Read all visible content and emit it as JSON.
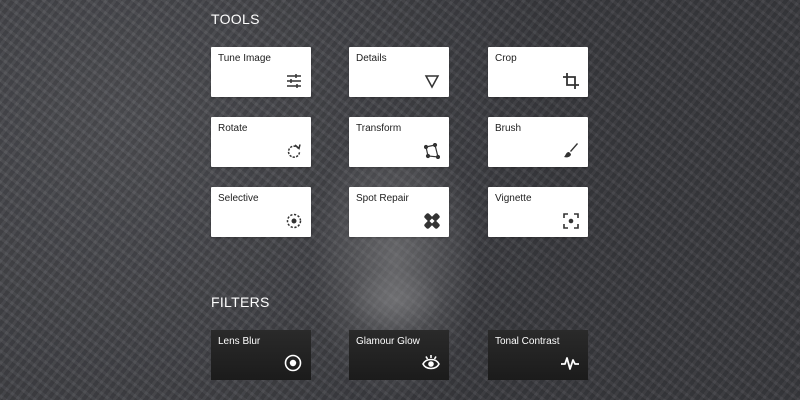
{
  "sections": {
    "tools_title": "TOOLS",
    "filters_title": "FILTERS"
  },
  "tools": [
    {
      "label": "Tune Image",
      "icon": "sliders-icon"
    },
    {
      "label": "Details",
      "icon": "triangle-down-icon"
    },
    {
      "label": "Crop",
      "icon": "crop-icon"
    },
    {
      "label": "Rotate",
      "icon": "rotate-icon"
    },
    {
      "label": "Transform",
      "icon": "perspective-icon"
    },
    {
      "label": "Brush",
      "icon": "brush-icon"
    },
    {
      "label": "Selective",
      "icon": "selective-icon"
    },
    {
      "label": "Spot Repair",
      "icon": "bandage-icon"
    },
    {
      "label": "Vignette",
      "icon": "vignette-icon"
    }
  ],
  "filters": [
    {
      "label": "Lens Blur",
      "icon": "lens-blur-icon"
    },
    {
      "label": "Glamour Glow",
      "icon": "eye-icon"
    },
    {
      "label": "Tonal Contrast",
      "icon": "pulse-icon"
    }
  ]
}
